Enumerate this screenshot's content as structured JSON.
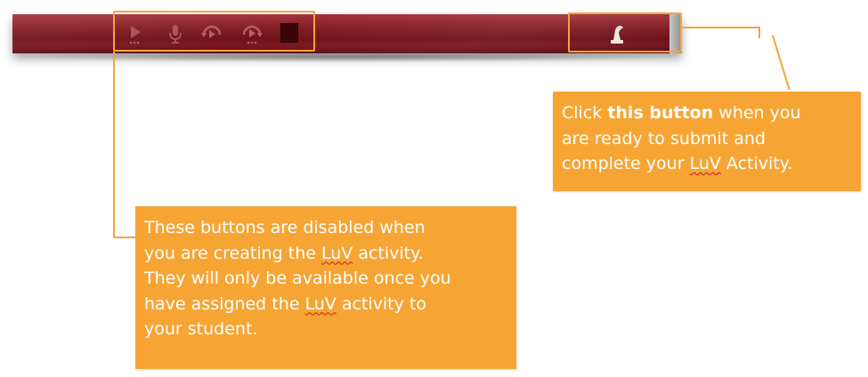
{
  "toolbar": {
    "buttons": [
      {
        "icon": "play-icon",
        "state": "disabled"
      },
      {
        "icon": "microphone-icon",
        "state": "disabled"
      },
      {
        "icon": "rewind-icon",
        "state": "disabled"
      },
      {
        "icon": "fast-forward-icon",
        "state": "disabled"
      },
      {
        "icon": "stop-icon",
        "state": "disabled"
      }
    ],
    "submit_icon": "submit-icon"
  },
  "colors": {
    "toolbar": "#8a1f27",
    "callout": "#f6a534",
    "highlight": "#f5a43a",
    "callout_text": "#ffffff"
  },
  "callout_submit": {
    "pre": "Click ",
    "bold": "this button",
    "post": " when you",
    "line2": "are ready to submit and",
    "line3_pre": "complete your ",
    "line3_luv": "LuV",
    "line3_post": " Activity."
  },
  "callout_disabled": {
    "line1": "These buttons are disabled when",
    "line2_pre": "you are creating the ",
    "line2_luv": "LuV",
    "line2_post": " activity.",
    "line3": "They will only be available once you",
    "line4_pre": "have assigned the ",
    "line4_luv": "LuV",
    "line4_post": " activity to",
    "line5": "your student."
  }
}
